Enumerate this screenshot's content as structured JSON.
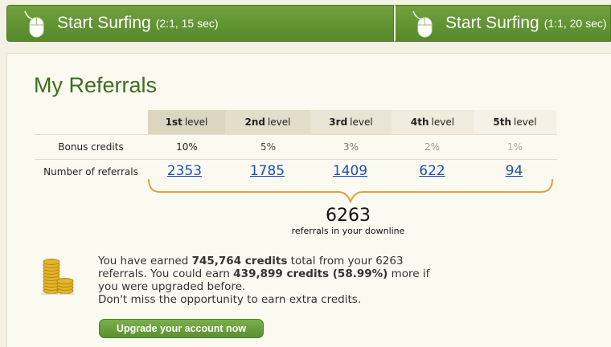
{
  "surf_buttons": [
    {
      "label": "Start Surfing",
      "sub": "(2:1, 15 sec)"
    },
    {
      "label": "Start Surfing",
      "sub": "(1:1, 20 sec)"
    }
  ],
  "title": "My Referrals",
  "levels": [
    {
      "num": "1st",
      "word": "level",
      "bg": "#dcd5bf"
    },
    {
      "num": "2nd",
      "word": "level",
      "bg": "#e3ddc9"
    },
    {
      "num": "3rd",
      "word": "level",
      "bg": "#e9e4d3"
    },
    {
      "num": "4th",
      "word": "level",
      "bg": "#efebdd"
    },
    {
      "num": "5th",
      "word": "level",
      "bg": "#f4f1e6"
    }
  ],
  "rows": {
    "bonus_label": "Bonus credits",
    "bonus_values": [
      "10%",
      "5%",
      "3%",
      "2%",
      "1%"
    ],
    "bonus_colors": [
      "#222222",
      "#444444",
      "#777777",
      "#999999",
      "#aaaaaa"
    ],
    "referrals_label": "Number of referrals",
    "referral_counts": [
      "2353",
      "1785",
      "1409",
      "622",
      "94"
    ]
  },
  "downline": {
    "total": "6263",
    "label": "referrals in your downline"
  },
  "earnings": {
    "t1": "You have earned ",
    "credits": "745,764 credits",
    "t2": " total from your 6263 referrals. You could earn ",
    "potential": "439,899 credits (58.99%)",
    "t3": " more if you were upgraded before.",
    "t4": "Don't miss the opportunity to earn extra credits."
  },
  "upgrade_label": "Upgrade your account now",
  "colors": {
    "accent_green": "#5f942f",
    "link_blue": "#1d4fb3",
    "brace_orange": "#e0a040"
  }
}
